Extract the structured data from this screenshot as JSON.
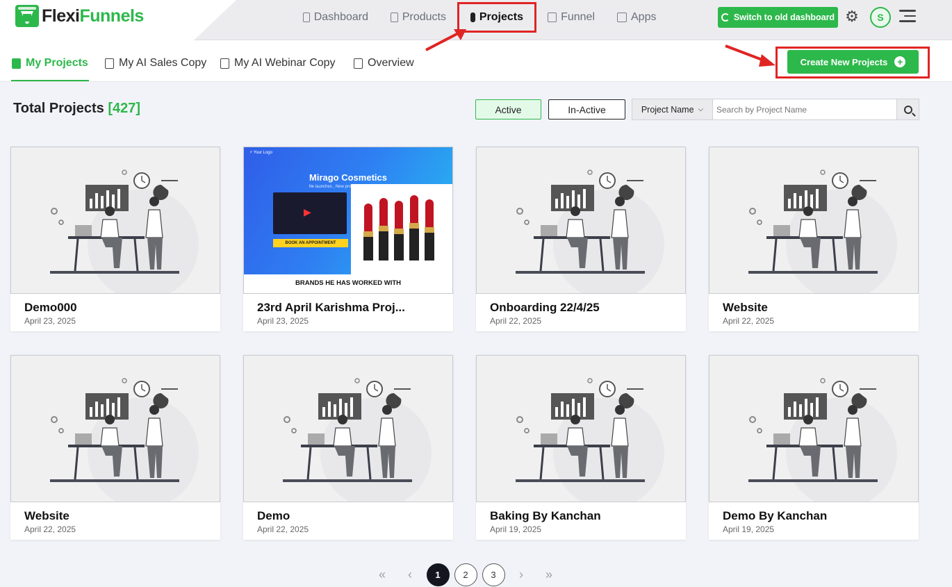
{
  "brand": {
    "name_part1": "Flexi",
    "name_part2": "Funnels"
  },
  "nav": {
    "items": [
      {
        "label": "Dashboard",
        "icon": "grid-icon"
      },
      {
        "label": "Products",
        "icon": "box-icon"
      },
      {
        "label": "Projects",
        "icon": "document-icon",
        "active": true
      },
      {
        "label": "Funnel",
        "icon": "funnel-icon"
      },
      {
        "label": "Apps",
        "icon": "apps-icon"
      }
    ]
  },
  "header": {
    "switch_label": "Switch to old dashboard",
    "avatar_initial": "S"
  },
  "tabs": [
    {
      "label": "My Projects",
      "active": true
    },
    {
      "label": "My AI Sales Copy"
    },
    {
      "label": "My AI Webinar Copy"
    },
    {
      "label": "Overview"
    }
  ],
  "create_button": {
    "label": "Create New Projects"
  },
  "summary": {
    "title": "Total Projects",
    "count": "[427]"
  },
  "filters": {
    "active_label": "Active",
    "inactive_label": "In-Active"
  },
  "search": {
    "select_label": "Project Name",
    "placeholder": "Search by Project Name"
  },
  "projects": [
    {
      "title": "Demo000",
      "date": "April 23, 2025",
      "thumb": "illustration"
    },
    {
      "title": "23rd April Karishma Proj...",
      "date": "April 23, 2025",
      "thumb": "cosmetics",
      "thumb_text": {
        "logo": "Your Logo",
        "heading": "Mirago Cosmetics",
        "tagline": "Ne launches , New products , New shades",
        "cta": "BOOK AN APPOINTMENT",
        "footer": "BRANDS HE HAS WORKED WITH"
      }
    },
    {
      "title": "Onboarding 22/4/25",
      "date": "April 22, 2025",
      "thumb": "illustration"
    },
    {
      "title": "Website",
      "date": "April 22, 2025",
      "thumb": "illustration"
    },
    {
      "title": "Website",
      "date": "April 22, 2025",
      "thumb": "illustration"
    },
    {
      "title": "Demo",
      "date": "April 22, 2025",
      "thumb": "illustration"
    },
    {
      "title": "Baking By Kanchan",
      "date": "April 19, 2025",
      "thumb": "illustration"
    },
    {
      "title": "Demo By Kanchan",
      "date": "April 19, 2025",
      "thumb": "illustration"
    }
  ],
  "pagination": {
    "pages": [
      "1",
      "2",
      "3"
    ],
    "current": "1"
  },
  "colors": {
    "brand_green": "#2db84b",
    "highlight_red": "#e02424",
    "dark": "#14161f"
  }
}
